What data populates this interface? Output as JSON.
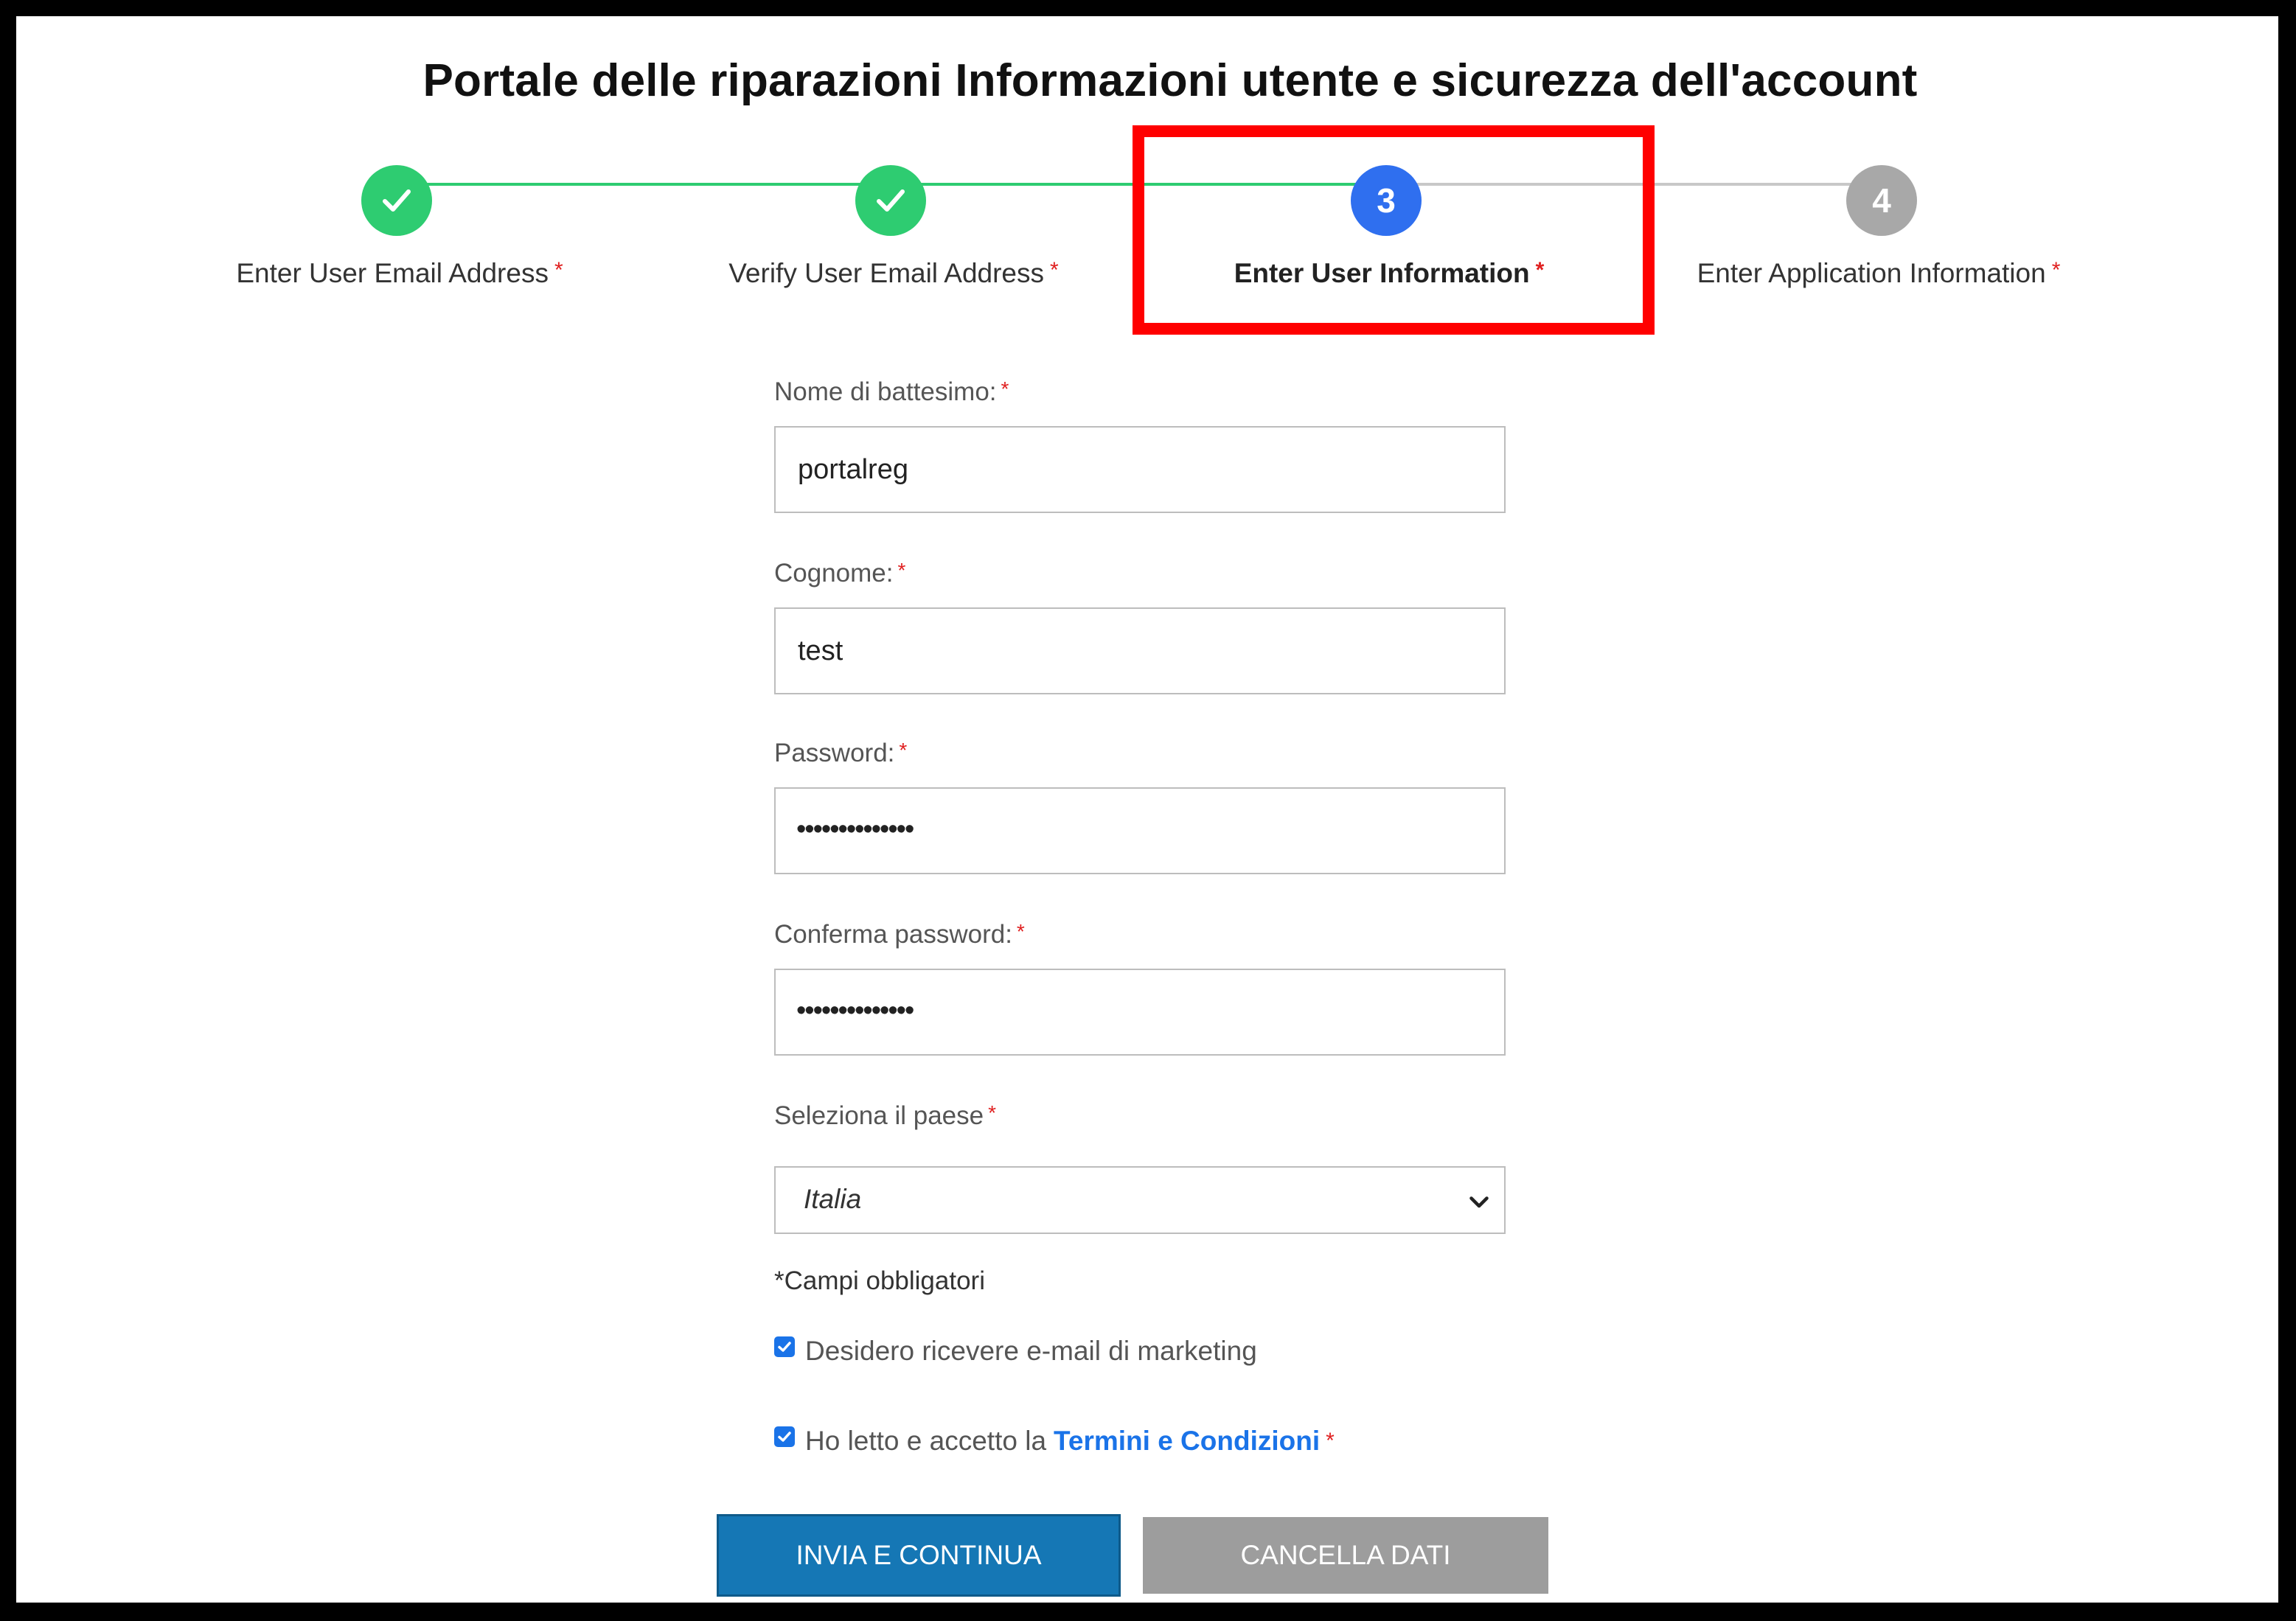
{
  "page": {
    "title": "Portale delle riparazioni Informazioni utente e sicurezza dell'account"
  },
  "stepper": {
    "steps": [
      {
        "number": "",
        "label": "Enter User Email Address",
        "required_mark": "*",
        "state": "done"
      },
      {
        "number": "",
        "label": "Verify User Email Address",
        "required_mark": "*",
        "state": "done"
      },
      {
        "number": "3",
        "label": "Enter User Information",
        "required_mark": "*",
        "state": "active"
      },
      {
        "number": "4",
        "label": "Enter Application Information",
        "required_mark": "*",
        "state": "todo"
      }
    ],
    "colors": {
      "done": "#2ecc71",
      "active": "#2f6fef",
      "todo": "#a8a8a8",
      "highlight": "#ff0000"
    }
  },
  "form": {
    "first_name": {
      "label": "Nome di battesimo:",
      "required_mark": "*",
      "value": "portalreg"
    },
    "last_name": {
      "label": "Cognome:",
      "required_mark": "*",
      "value": "test"
    },
    "password": {
      "label": "Password:",
      "required_mark": "*",
      "masked_value": "••••••••••••••"
    },
    "confirm_password": {
      "label": "Conferma password:",
      "required_mark": "*",
      "masked_value": "••••••••••••••"
    },
    "country": {
      "label": "Seleziona il paese",
      "required_mark": "*",
      "selected": "Italia",
      "icon": "chevron-down-icon"
    },
    "required_note": "*Campi obbligatori",
    "marketing_checkbox": {
      "label": "Desidero ricevere e-mail di marketing",
      "checked": true
    },
    "terms_checkbox": {
      "label": "Ho letto e accetto la",
      "link_text": "Termini e Condizioni",
      "required_mark": "*",
      "checked": true
    }
  },
  "buttons": {
    "submit": "INVIA E CONTINUA",
    "clear": "CANCELLA DATI"
  }
}
